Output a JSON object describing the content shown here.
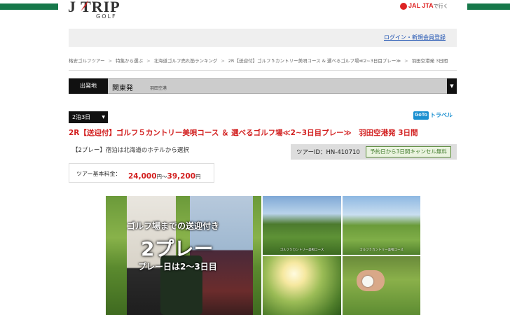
{
  "header": {
    "logo_main": "J TRIP",
    "logo_sub": "GOLF",
    "partner": "JAL JTA",
    "partner_suffix": "で行く",
    "accent_green": "#16784a"
  },
  "account": {
    "login_link": "ログイン・新規会員登録"
  },
  "breadcrumb": [
    "格安ゴルフツアー",
    "特集から選ぶ",
    "北海道ゴルフ売れ筋ランキング",
    "2R【送迎付】ゴルフ５カントリー美唄コース & 選べるゴルフ場≪2~3日目プレー≫",
    "羽田空港発 3日間"
  ],
  "departure": {
    "label": "出発地",
    "value": "関東発",
    "sub": "羽田空港"
  },
  "nights": {
    "selected": "2泊3日"
  },
  "goto_badge": {
    "mark": "GoTo",
    "text": "トラベル"
  },
  "tour": {
    "title": "2R【送迎付】ゴルフ５カントリー美唄コース ＆ 選べるゴルフ場≪2~3日目プレー≫　羽田空港発 3日間",
    "description": "【2プレー】宿泊は北海道のホテルから選択",
    "id_label": "ツアーID：HN-410710",
    "cancel_badge": "予約日から3日間キャンセル無料",
    "price_label": "ツアー基本料金：",
    "price_from": "24,000",
    "price_to": "39,200",
    "price_unit": "円",
    "price_sep": "～"
  },
  "photos": {
    "main_line1": "ゴルフ場までの送迎付き",
    "main_line2": "2プレー",
    "main_line3": "プレー日は2～3日目",
    "caption_a": "ゴルフ５カントリー美唄コース",
    "caption_b": "ゴルフ５カントリー美唄コース"
  }
}
